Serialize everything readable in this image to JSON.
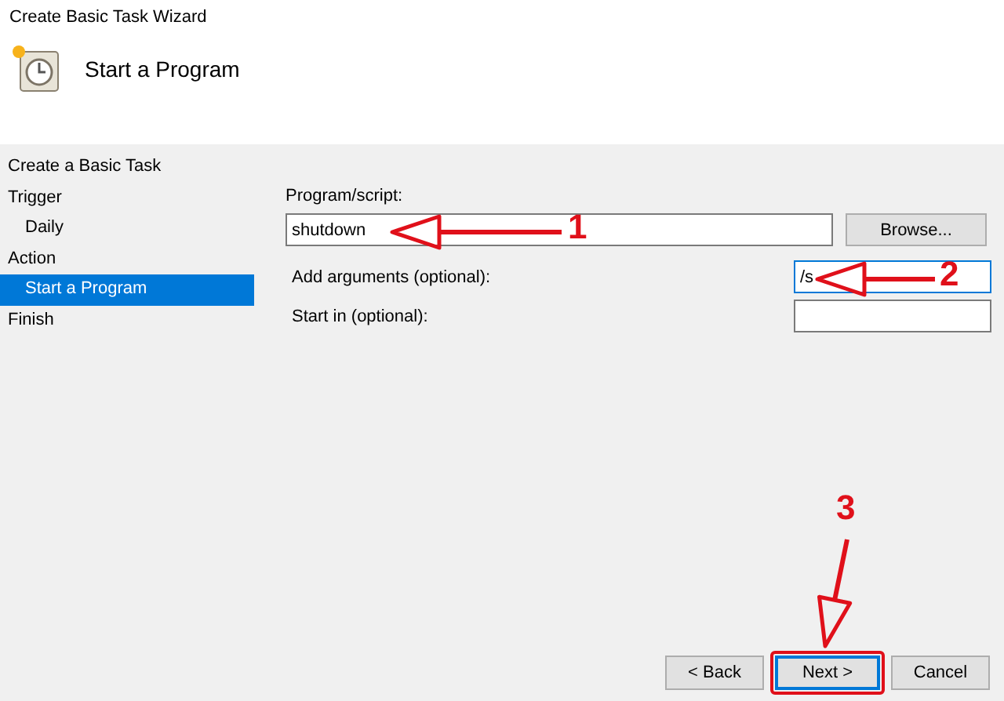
{
  "window": {
    "title": "Create Basic Task Wizard"
  },
  "header": {
    "title": "Start a Program"
  },
  "steps": [
    {
      "label": "Create a Basic Task",
      "indented": false,
      "selected": false
    },
    {
      "label": "Trigger",
      "indented": false,
      "selected": false
    },
    {
      "label": "Daily",
      "indented": true,
      "selected": false
    },
    {
      "label": "Action",
      "indented": false,
      "selected": false
    },
    {
      "label": "Start a Program",
      "indented": true,
      "selected": true
    },
    {
      "label": "Finish",
      "indented": false,
      "selected": false
    }
  ],
  "program": {
    "label": "Program/script:",
    "value": "shutdown",
    "browse": "Browse..."
  },
  "arguments": {
    "label": "Add arguments (optional):",
    "value": "/s",
    "focused": true
  },
  "start_in": {
    "label": "Start in (optional):"
  },
  "buttons": [
    {
      "label": "< Back",
      "default": false,
      "highlighted": false
    },
    {
      "label": "Next >",
      "default": true,
      "highlighted": true
    },
    {
      "label": "Cancel",
      "default": false,
      "highlighted": false
    }
  ],
  "annotations": [
    {
      "label": "1"
    },
    {
      "label": "2"
    },
    {
      "label": "3"
    }
  ]
}
